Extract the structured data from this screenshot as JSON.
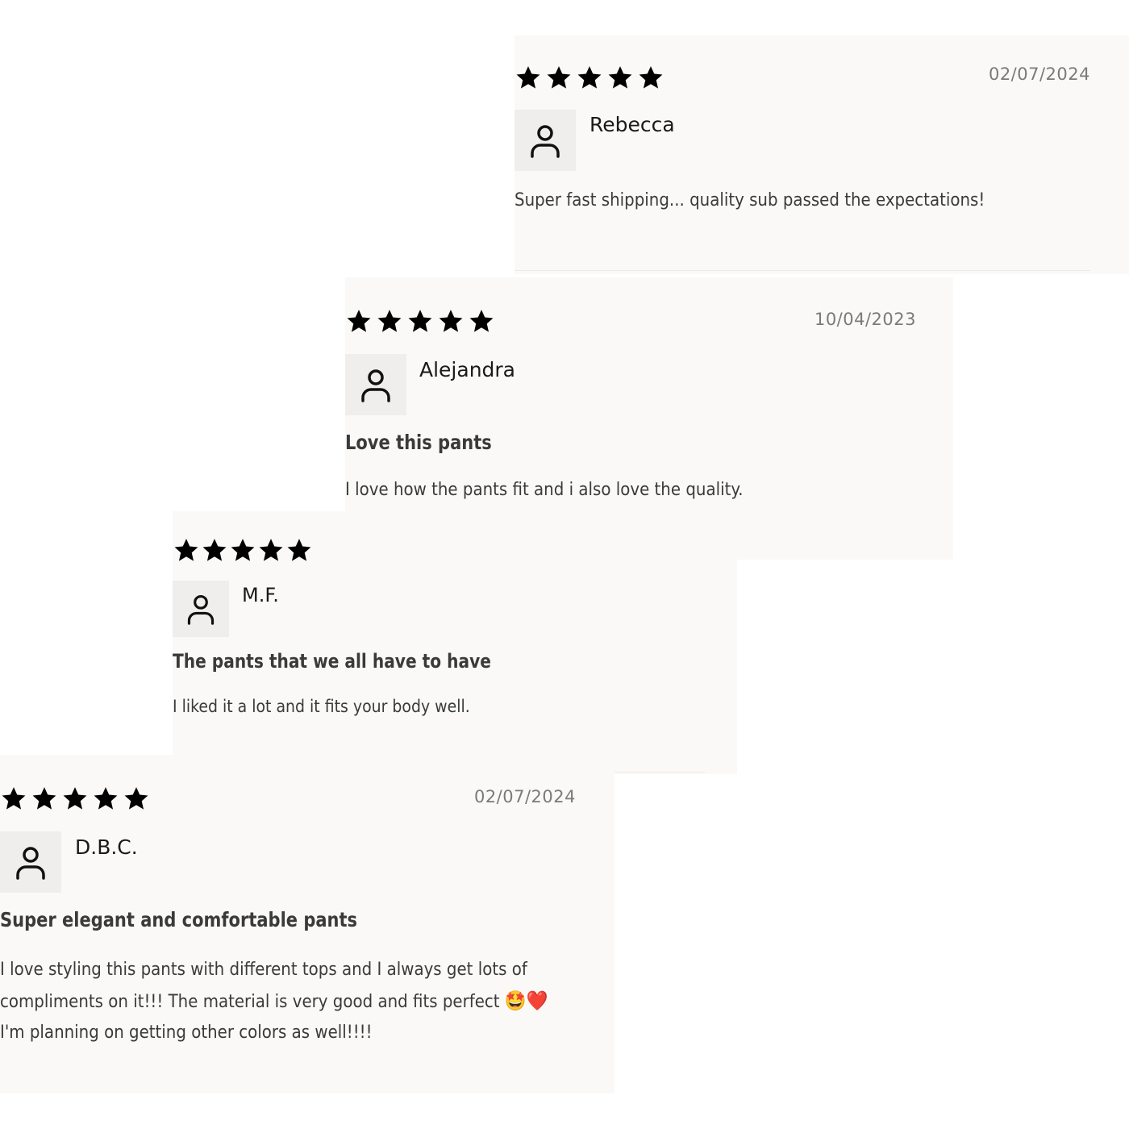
{
  "reviews": [
    {
      "rating": 5,
      "date": "02/07/2024",
      "author": "Rebecca",
      "title": "",
      "body": "Super fast shipping... quality sub passed the expectations!"
    },
    {
      "rating": 5,
      "date": "10/04/2023",
      "author": "Alejandra",
      "title": "Love this pants",
      "body": "I love how the pants fit and i also love the quality."
    },
    {
      "rating": 5,
      "date": "",
      "author": "M.F.",
      "title": "The pants that we all have to have",
      "body": "I liked it a lot and it fits your body well."
    },
    {
      "rating": 5,
      "date": "02/07/2024",
      "author": "D.B.C.",
      "title": "Super elegant and comfortable pants",
      "body_lines": [
        "I love styling this pants with different tops and I always get lots of",
        "compliments on it!!! The material is very good and fits perfect",
        "I'm planning on getting other colors as well!!!!"
      ],
      "body_emoji": "🤩❤️"
    }
  ],
  "icons": {
    "star": "star-icon",
    "avatar": "user-icon"
  },
  "colors": {
    "card_bg": "#faf9f7",
    "star": "#000000",
    "date": "#7a7a7a",
    "avatar_bg": "#efeeec"
  }
}
